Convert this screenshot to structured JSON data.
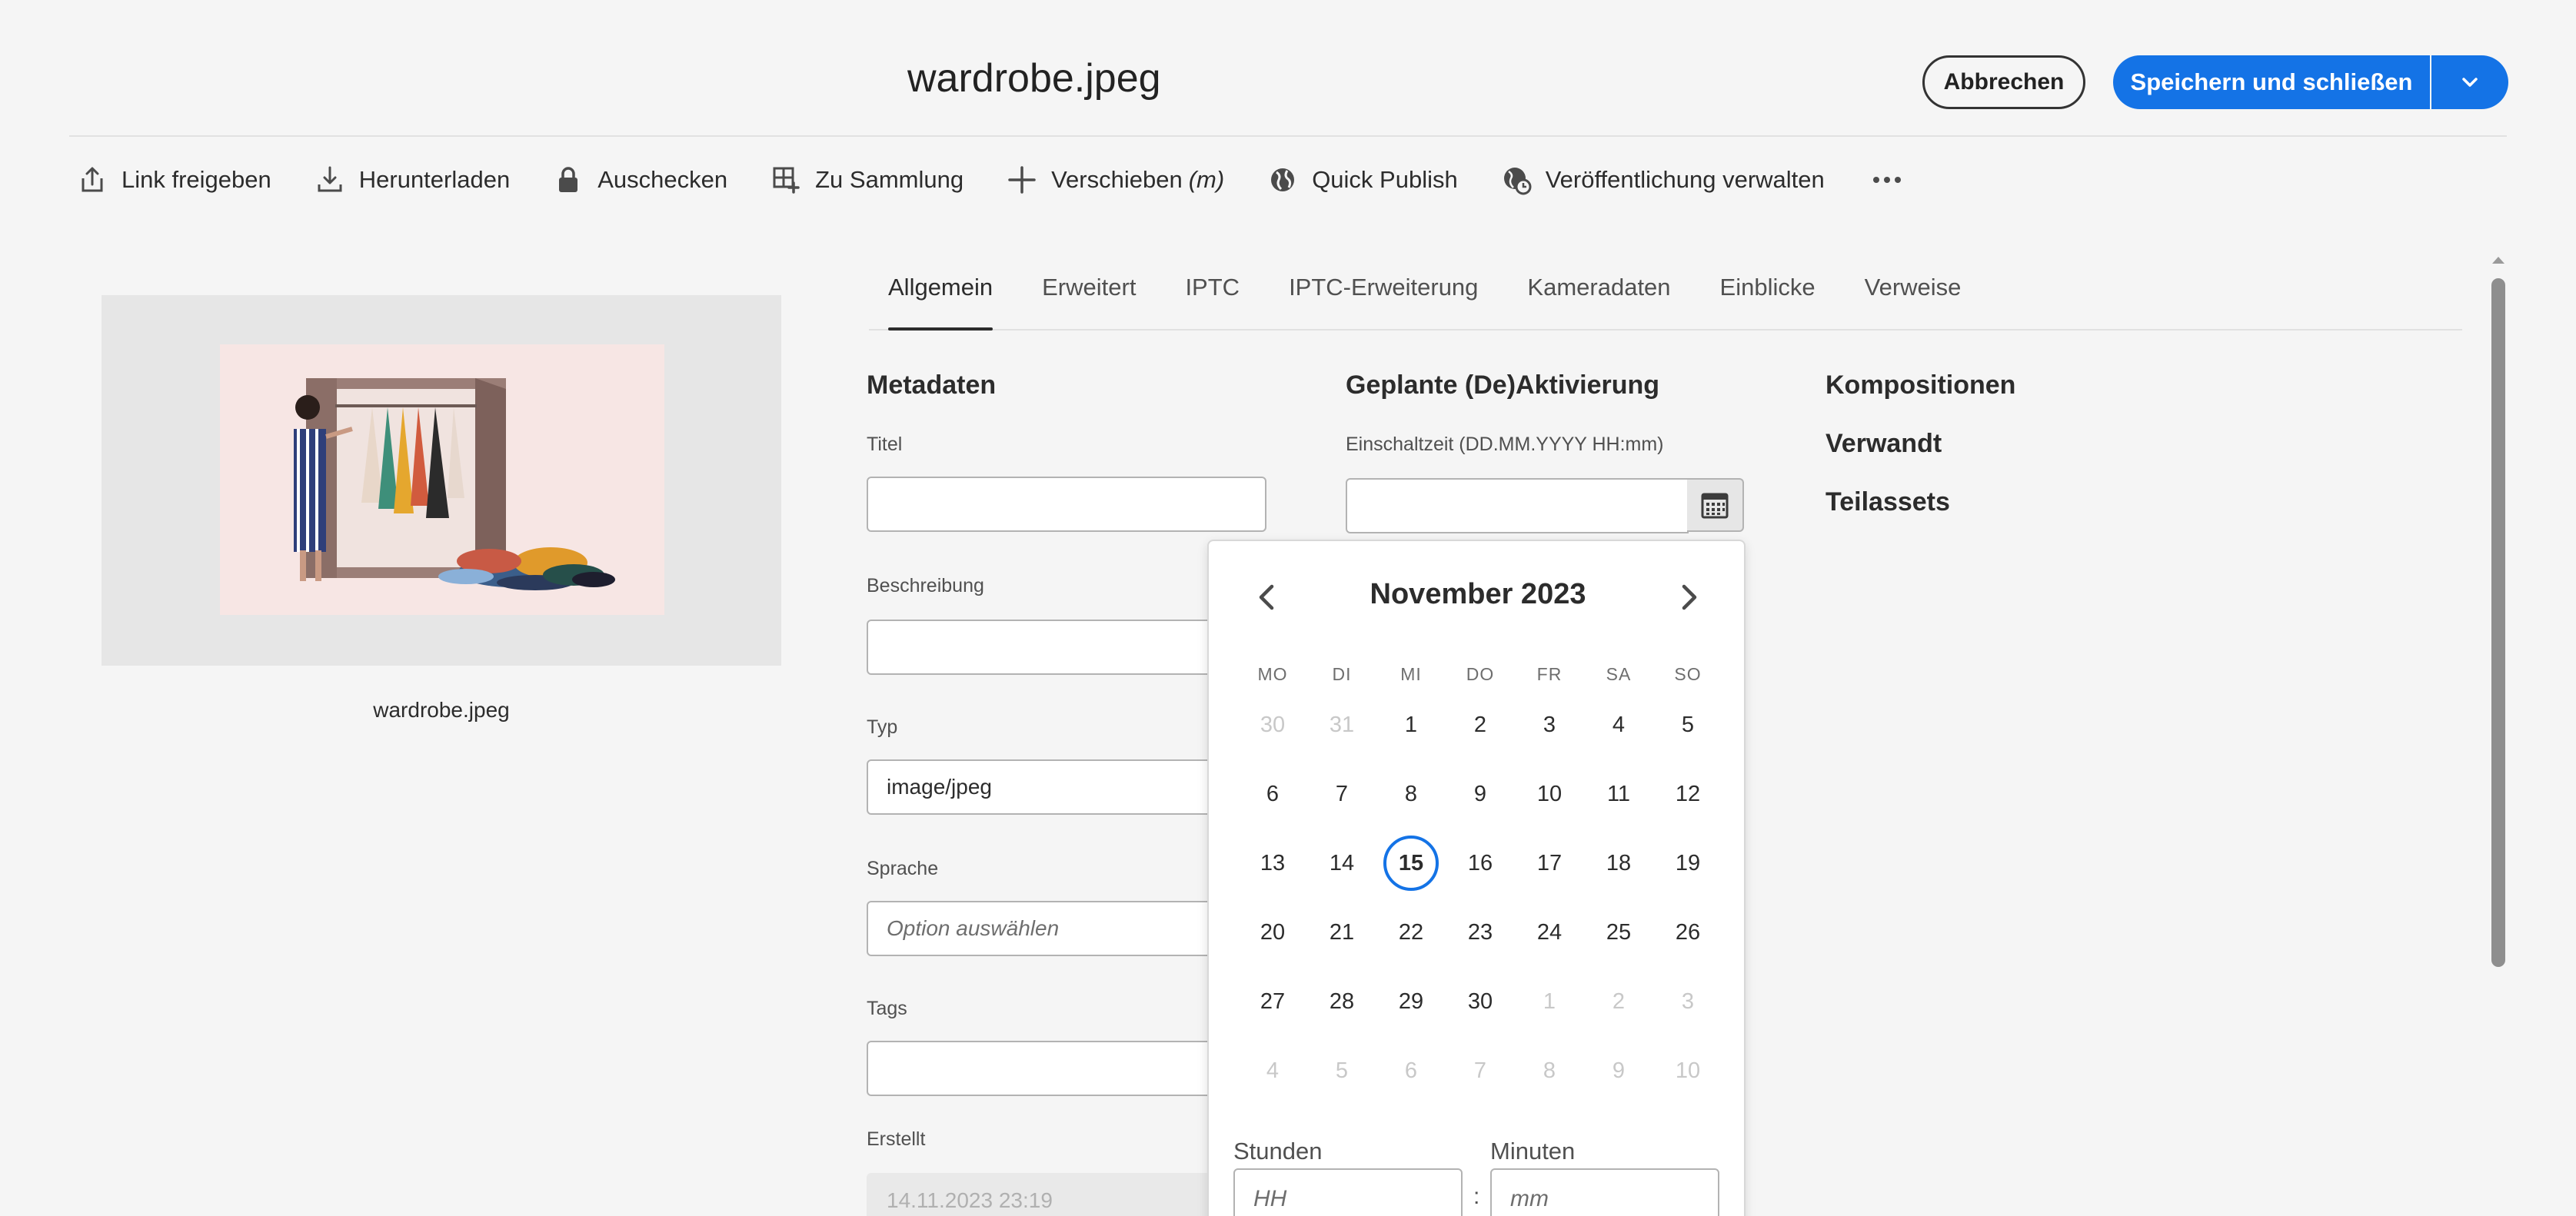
{
  "header": {
    "title": "wardrobe.jpeg",
    "cancel_label": "Abbrechen",
    "save_label": "Speichern und schließen"
  },
  "toolbar": {
    "items": [
      {
        "label": "Link freigeben",
        "icon": "share-icon"
      },
      {
        "label": "Herunterladen",
        "icon": "download-icon"
      },
      {
        "label": "Auschecken",
        "icon": "lock-icon"
      },
      {
        "label": "Zu Sammlung",
        "icon": "add-collection-icon"
      },
      {
        "label": "Verschieben",
        "suffix": "(m)",
        "icon": "move-icon"
      },
      {
        "label": "Quick Publish",
        "icon": "globe-icon"
      },
      {
        "label": "Veröffentlichung verwalten",
        "icon": "globe-clock-icon"
      }
    ]
  },
  "preview": {
    "caption": "wardrobe.jpeg"
  },
  "tabs": [
    "Allgemein",
    "Erweitert",
    "IPTC",
    "IPTC-Erweiterung",
    "Kameradaten",
    "Einblicke",
    "Verweise"
  ],
  "metadata": {
    "heading": "Metadaten",
    "title_label": "Titel",
    "title_value": "",
    "description_label": "Beschreibung",
    "description_value": "",
    "type_label": "Typ",
    "type_value": "image/jpeg",
    "language_label": "Sprache",
    "language_placeholder": "Option auswählen",
    "tags_label": "Tags",
    "tags_value": "",
    "created_label": "Erstellt",
    "created_value": "14.11.2023 23:19"
  },
  "scheduling": {
    "heading": "Geplante (De)Aktivierung",
    "on_time_label": "Einschaltzeit (DD.MM.YYYY HH:mm)",
    "on_time_value": ""
  },
  "right_sections": [
    "Kompositionen",
    "Verwandt",
    "Teilassets"
  ],
  "calendar": {
    "month_title": "November 2023",
    "weekdays": [
      "MO",
      "DI",
      "MI",
      "DO",
      "FR",
      "SA",
      "SO"
    ],
    "days": [
      {
        "d": "30",
        "m": true
      },
      {
        "d": "31",
        "m": true
      },
      {
        "d": "1"
      },
      {
        "d": "2"
      },
      {
        "d": "3"
      },
      {
        "d": "4"
      },
      {
        "d": "5"
      },
      {
        "d": "6"
      },
      {
        "d": "7"
      },
      {
        "d": "8"
      },
      {
        "d": "9"
      },
      {
        "d": "10"
      },
      {
        "d": "11"
      },
      {
        "d": "12"
      },
      {
        "d": "13"
      },
      {
        "d": "14"
      },
      {
        "d": "15",
        "today": true
      },
      {
        "d": "16"
      },
      {
        "d": "17"
      },
      {
        "d": "18"
      },
      {
        "d": "19"
      },
      {
        "d": "20"
      },
      {
        "d": "21"
      },
      {
        "d": "22"
      },
      {
        "d": "23"
      },
      {
        "d": "24"
      },
      {
        "d": "25"
      },
      {
        "d": "26"
      },
      {
        "d": "27"
      },
      {
        "d": "28"
      },
      {
        "d": "29"
      },
      {
        "d": "30"
      },
      {
        "d": "1",
        "m": true
      },
      {
        "d": "2",
        "m": true
      },
      {
        "d": "3",
        "m": true
      },
      {
        "d": "4",
        "m": true
      },
      {
        "d": "5",
        "m": true
      },
      {
        "d": "6",
        "m": true
      },
      {
        "d": "7",
        "m": true
      },
      {
        "d": "8",
        "m": true
      },
      {
        "d": "9",
        "m": true
      },
      {
        "d": "10",
        "m": true
      }
    ],
    "hours_label": "Stunden",
    "hours_placeholder": "HH",
    "minutes_label": "Minuten",
    "minutes_placeholder": "mm",
    "time_separator": ":"
  },
  "colors": {
    "accent": "#1473e6",
    "background": "#f5f5f5"
  }
}
